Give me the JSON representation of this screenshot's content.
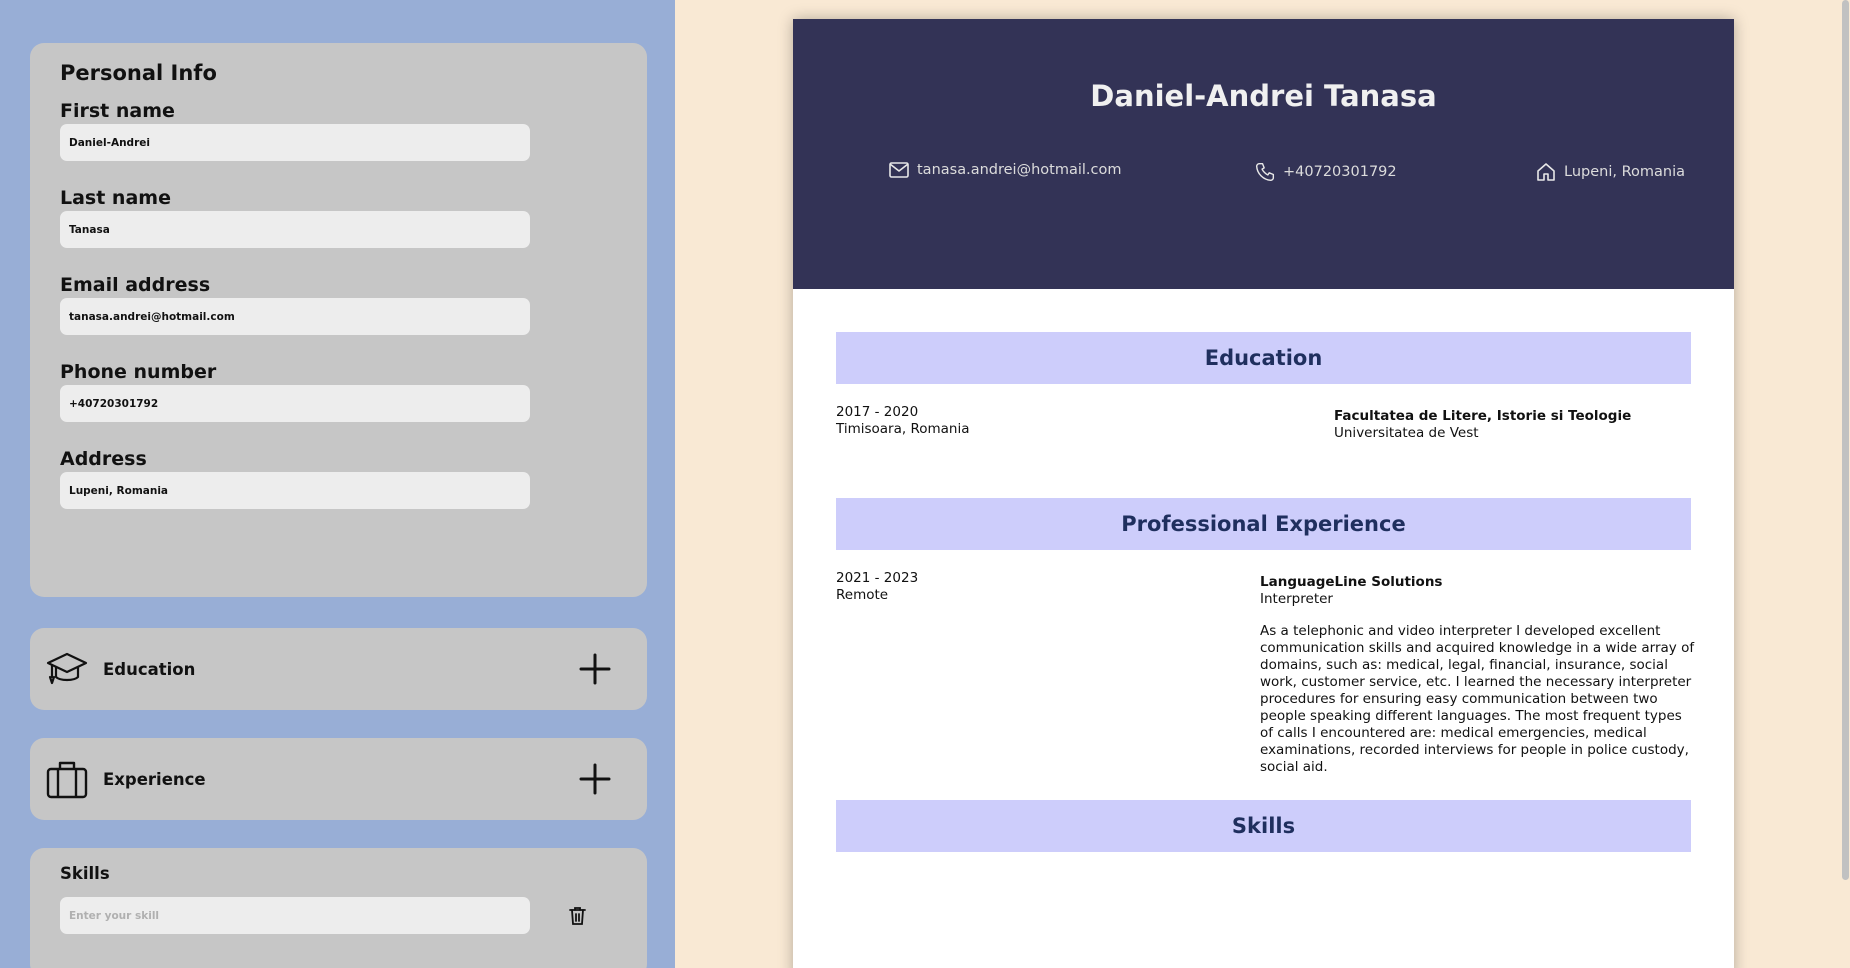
{
  "editor": {
    "personal": {
      "title": "Personal Info",
      "fields": {
        "first_name": {
          "label": "First name",
          "value": "Daniel-Andrei"
        },
        "last_name": {
          "label": "Last name",
          "value": "Tanasa"
        },
        "email": {
          "label": "Email address",
          "value": "tanasa.andrei@hotmail.com"
        },
        "phone": {
          "label": "Phone number",
          "value": "+40720301792"
        },
        "address": {
          "label": "Address",
          "value": "Lupeni, Romania"
        }
      }
    },
    "education": {
      "label": "Education",
      "icon": "graduation-cap-icon"
    },
    "experience": {
      "label": "Experience",
      "icon": "briefcase-icon"
    },
    "skills": {
      "title": "Skills",
      "placeholder": "Enter your skill"
    }
  },
  "resume": {
    "name": "Daniel-Andrei Tanasa",
    "contact": {
      "email": "tanasa.andrei@hotmail.com",
      "phone": "+40720301792",
      "address": "Lupeni, Romania"
    },
    "education_title": "Education",
    "education": [
      {
        "years": "2017 - 2020",
        "location": "Timisoara, Romania",
        "faculty": "Facultatea de Litere, Istorie si Teologie",
        "university": "Universitatea de Vest"
      }
    ],
    "experience_title": "Professional Experience",
    "experience": [
      {
        "years": "2021 - 2023",
        "location": "Remote",
        "company": "LanguageLine Solutions",
        "position": "Interpreter",
        "description": "As a telephonic and video interpreter I developed excellent communication skills and acquired knowledge in a wide array of domains, such as: medical, legal, financial, insurance, social work, customer service, etc. I learned the necessary interpreter procedures for ensuring easy communication between two people speaking different languages. The most frequent types of calls I encountered are: medical emergencies, medical examinations, recorded interviews for people in police custody, social aid."
      }
    ],
    "skills_title": "Skills"
  },
  "colors": {
    "editor_bg": "#98aed6",
    "card_bg": "#c6c6c6",
    "page_bg": "#f9e9d4",
    "header_bg": "#333356",
    "section_bar_bg": "#cdcdfb",
    "section_title": "#1f2f5e"
  }
}
